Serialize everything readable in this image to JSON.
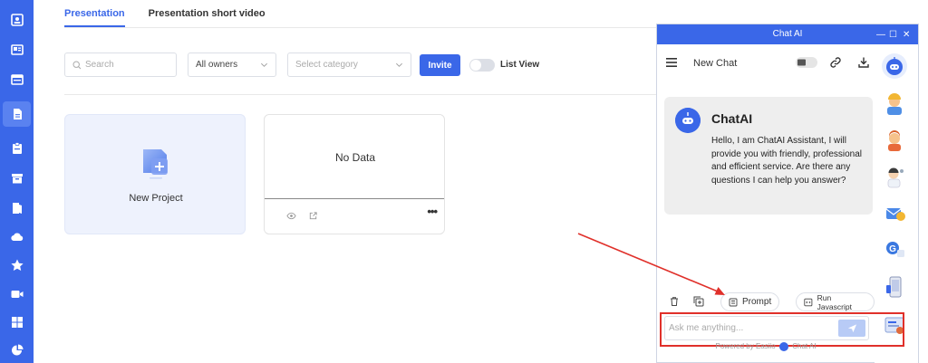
{
  "sidebar": {
    "items": [
      {
        "icon": "contact-card-icon"
      },
      {
        "icon": "news-icon"
      },
      {
        "icon": "window-icon"
      },
      {
        "icon": "document-icon",
        "active": true
      },
      {
        "icon": "clipboard-icon"
      },
      {
        "icon": "archive-icon"
      },
      {
        "icon": "book-icon"
      },
      {
        "icon": "cloud-icon"
      },
      {
        "icon": "star-icon"
      },
      {
        "icon": "video-icon"
      },
      {
        "icon": "grid-icon"
      },
      {
        "icon": "pie-chart-icon"
      }
    ]
  },
  "tabs": [
    {
      "label": "Presentation",
      "active": true
    },
    {
      "label": "Presentation short video",
      "active": false
    }
  ],
  "filters": {
    "search_placeholder": "Search",
    "owners_value": "All owners",
    "category_placeholder": "Select category",
    "invite_label": "Invite",
    "list_view_label": "List View",
    "list_view_on": false
  },
  "cards": {
    "new_project_label": "New Project",
    "no_data_label": "No Data",
    "more_label": "•••"
  },
  "chat": {
    "window_title": "Chat AI",
    "new_chat_label": "New Chat",
    "assistant_name": "ChatAI",
    "greeting": "Hello, I am ChatAI Assistant, I will provide you with friendly, professional and efficient service. Are there any questions I can help you answer?",
    "prompt_label": "Prompt",
    "run_js_label": "Run Javascript",
    "input_placeholder": "Ask me anything...",
    "powered_prefix": "Powered by Easiio",
    "powered_suffix": "Chat AI"
  },
  "colors": {
    "accent": "#3a67e8",
    "annotation": "#e0302a"
  }
}
